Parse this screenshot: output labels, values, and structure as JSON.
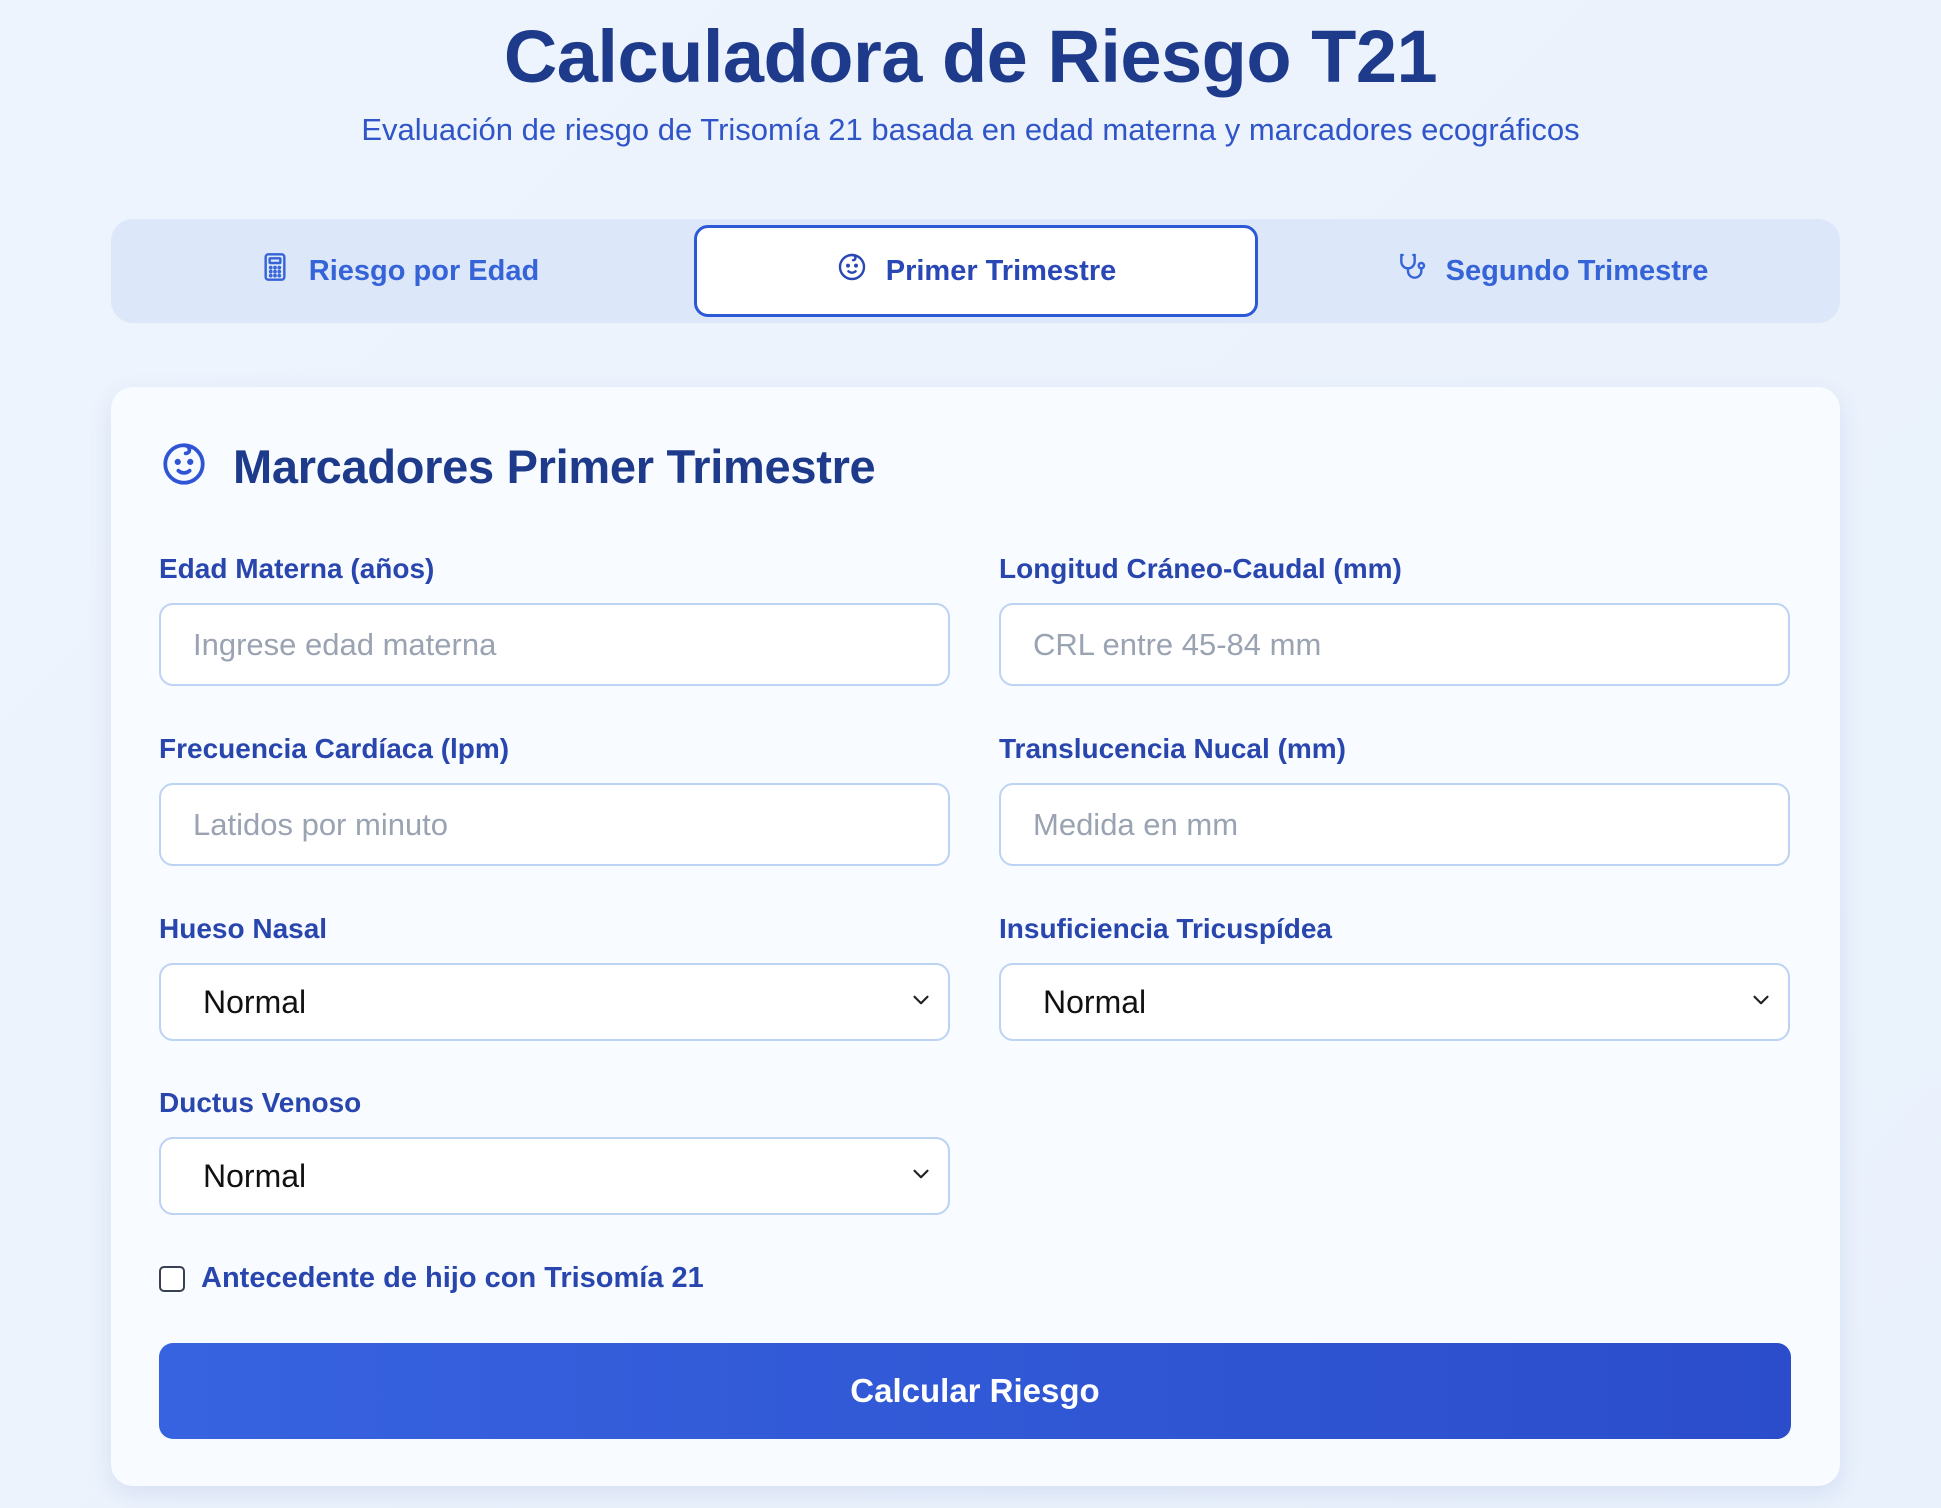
{
  "header": {
    "title": "Calculadora de Riesgo T21",
    "subtitle": "Evaluación de riesgo de Trisomía 21 basada en edad materna y marcadores ecográficos"
  },
  "tabs": [
    {
      "label": "Riesgo por Edad",
      "icon": "calculator-icon",
      "active": false
    },
    {
      "label": "Primer Trimestre",
      "icon": "baby-face-icon",
      "active": true
    },
    {
      "label": "Segundo Trimestre",
      "icon": "stethoscope-icon",
      "active": false
    }
  ],
  "card": {
    "title": "Marcadores Primer Trimestre",
    "icon": "baby-face-icon"
  },
  "form": {
    "maternal_age": {
      "label": "Edad Materna (años)",
      "placeholder": "Ingrese edad materna",
      "value": ""
    },
    "crl": {
      "label": "Longitud Cráneo-Caudal (mm)",
      "placeholder": "CRL entre 45-84 mm",
      "value": ""
    },
    "heart_rate": {
      "label": "Frecuencia Cardíaca (lpm)",
      "placeholder": "Latidos por minuto",
      "value": ""
    },
    "nuchal": {
      "label": "Translucencia Nucal (mm)",
      "placeholder": "Medida en mm",
      "value": ""
    },
    "nasal_bone": {
      "label": "Hueso Nasal",
      "value": "Normal"
    },
    "tricuspid": {
      "label": "Insuficiencia Tricuspídea",
      "value": "Normal"
    },
    "ductus": {
      "label": "Ductus Venoso",
      "value": "Normal"
    },
    "history": {
      "label": "Antecedente de hijo con Trisomía 21",
      "checked": false
    },
    "submit_label": "Calcular Riesgo"
  },
  "colors": {
    "primary": "#2f55d4",
    "heading": "#1e3a8a",
    "background": "#eef4fd"
  }
}
